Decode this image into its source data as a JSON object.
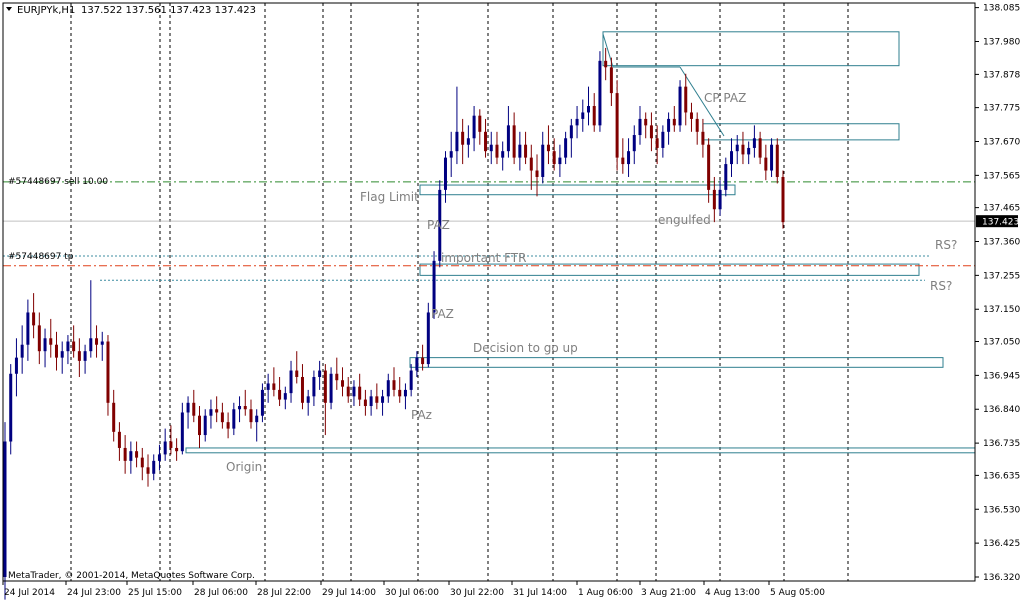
{
  "header": {
    "symbol_label": "EURJPYk,H1",
    "ohlc_label": "137.522 137.561 137.423 137.423"
  },
  "footer": {
    "copyright": "MetaTrader, © 2001-2014, MetaQuotes Software Corp."
  },
  "orders": {
    "sell_label": "#57448697 sell 10.00",
    "tp_label": "#57448697 tp"
  },
  "colors": {
    "background": "#ffffff",
    "grid": "#000000",
    "bull_candle": "#000080",
    "bear_candle": "#800000",
    "zone": "#2f7f8f",
    "annotation_text": "#808080",
    "sell_line": "#2e8b2e",
    "tp_line": "#e0401a",
    "dotted_level": "#3c8ca0",
    "bid_box": "#000000"
  },
  "chart_data": {
    "type": "candlestick",
    "title": "EURJPYk,H1",
    "ylim": [
      136.32,
      138.09
    ],
    "y_ticks": [
      "138.085",
      "137.980",
      "137.878",
      "137.775",
      "137.670",
      "137.565",
      "137.465",
      "137.360",
      "137.255",
      "137.150",
      "137.050",
      "136.945",
      "136.840",
      "136.735",
      "136.635",
      "136.530",
      "136.425",
      "136.320"
    ],
    "x_ticks": [
      "24 Jul 2014",
      "24 Jul 23:00",
      "25 Jul 15:00",
      "28 Jul 06:00",
      "28 Jul 22:00",
      "29 Jul 14:00",
      "30 Jul 06:00",
      "30 Jul 22:00",
      "31 Jul 14:00",
      "1 Aug 06:00",
      "3 Aug 21:00",
      "4 Aug 13:00",
      "5 Aug 05:00"
    ],
    "current_price": "137.423",
    "sell_level": 137.545,
    "tp_level": 137.285,
    "resistance_levels": [
      137.315,
      137.24
    ],
    "zones": [
      {
        "label": "",
        "y_top": 138.01,
        "y_bottom": 137.905
      },
      {
        "label": "",
        "y_top": 137.725,
        "y_bottom": 137.675
      },
      {
        "label": "",
        "y_top": 137.535,
        "y_bottom": 137.505
      },
      {
        "label": "",
        "y_top": 137.29,
        "y_bottom": 137.255
      },
      {
        "label": "",
        "y_top": 137.0,
        "y_bottom": 136.97
      },
      {
        "label": "",
        "y_top": 136.72,
        "y_bottom": 136.705
      }
    ],
    "annotations": [
      "CP PAZ",
      "Flag Limit",
      "PAZ",
      "engulfed",
      "important FTR",
      "RS?",
      "RS?",
      "PAZ",
      "Decision to go up",
      "PAz",
      "Origin"
    ],
    "candles": [
      [
        136.32,
        136.8,
        136.25,
        136.74
      ],
      [
        136.74,
        136.98,
        136.7,
        136.95
      ],
      [
        136.95,
        137.06,
        136.88,
        137.0
      ],
      [
        137.0,
        137.1,
        136.95,
        137.04
      ],
      [
        137.04,
        137.18,
        136.99,
        137.14
      ],
      [
        137.14,
        137.2,
        137.06,
        137.1
      ],
      [
        137.1,
        137.14,
        136.98,
        137.02
      ],
      [
        137.02,
        137.09,
        136.97,
        137.06
      ],
      [
        137.06,
        137.12,
        137.0,
        137.04
      ],
      [
        137.04,
        137.08,
        136.96,
        137.0
      ],
      [
        137.0,
        137.05,
        136.95,
        137.02
      ],
      [
        137.02,
        137.07,
        136.98,
        137.05
      ],
      [
        137.05,
        137.1,
        137.0,
        137.02
      ],
      [
        137.02,
        137.06,
        136.94,
        136.99
      ],
      [
        136.99,
        137.04,
        136.95,
        137.02
      ],
      [
        137.02,
        137.24,
        137.0,
        137.06
      ],
      [
        137.06,
        137.1,
        137.0,
        137.04
      ],
      [
        137.04,
        137.08,
        136.99,
        137.05
      ],
      [
        137.05,
        137.07,
        136.82,
        136.86
      ],
      [
        136.86,
        136.9,
        136.74,
        136.77
      ],
      [
        136.77,
        136.8,
        136.68,
        136.72
      ],
      [
        136.72,
        136.76,
        136.64,
        136.68
      ],
      [
        136.68,
        136.74,
        136.64,
        136.71
      ],
      [
        136.71,
        136.74,
        136.66,
        136.69
      ],
      [
        136.69,
        136.72,
        136.62,
        136.66
      ],
      [
        136.66,
        136.7,
        136.6,
        136.64
      ],
      [
        136.64,
        136.7,
        136.62,
        136.68
      ],
      [
        136.68,
        136.73,
        136.65,
        136.7
      ],
      [
        136.7,
        136.78,
        136.68,
        136.74
      ],
      [
        136.74,
        136.79,
        136.7,
        136.72
      ],
      [
        136.72,
        136.75,
        136.68,
        136.71
      ],
      [
        136.71,
        136.86,
        136.7,
        136.83
      ],
      [
        136.83,
        136.88,
        136.78,
        136.86
      ],
      [
        136.86,
        136.9,
        136.8,
        136.82
      ],
      [
        136.82,
        136.85,
        136.72,
        136.76
      ],
      [
        136.76,
        136.84,
        136.74,
        136.82
      ],
      [
        136.82,
        136.87,
        136.78,
        136.84
      ],
      [
        136.84,
        136.88,
        136.8,
        136.83
      ],
      [
        136.83,
        136.86,
        136.78,
        136.8
      ],
      [
        136.8,
        136.83,
        136.75,
        136.78
      ],
      [
        136.78,
        136.86,
        136.76,
        136.84
      ],
      [
        136.84,
        136.88,
        136.8,
        136.85
      ],
      [
        136.85,
        136.9,
        136.82,
        136.84
      ],
      [
        136.84,
        136.87,
        136.78,
        136.8
      ],
      [
        136.8,
        136.84,
        136.74,
        136.82
      ],
      [
        136.82,
        136.92,
        136.8,
        136.9
      ],
      [
        136.9,
        136.95,
        136.86,
        136.92
      ],
      [
        136.92,
        136.97,
        136.88,
        136.9
      ],
      [
        136.9,
        136.94,
        136.85,
        136.87
      ],
      [
        136.87,
        136.91,
        136.84,
        136.89
      ],
      [
        136.89,
        136.99,
        136.86,
        136.96
      ],
      [
        136.96,
        137.02,
        136.92,
        136.94
      ],
      [
        136.94,
        136.98,
        136.84,
        136.86
      ],
      [
        136.86,
        136.9,
        136.82,
        136.88
      ],
      [
        136.88,
        136.96,
        136.85,
        136.94
      ],
      [
        136.94,
        136.99,
        136.9,
        136.96
      ],
      [
        136.96,
        136.98,
        136.76,
        136.86
      ],
      [
        136.86,
        136.97,
        136.84,
        136.95
      ],
      [
        136.95,
        137.0,
        136.9,
        136.93
      ],
      [
        136.93,
        136.97,
        136.88,
        136.91
      ],
      [
        136.91,
        136.94,
        136.86,
        136.88
      ],
      [
        136.88,
        136.93,
        136.85,
        136.91
      ],
      [
        136.91,
        136.95,
        136.85,
        136.87
      ],
      [
        136.87,
        136.9,
        136.82,
        136.85
      ],
      [
        136.85,
        136.9,
        136.82,
        136.88
      ],
      [
        136.88,
        136.92,
        136.84,
        136.86
      ],
      [
        136.86,
        136.9,
        136.82,
        136.88
      ],
      [
        136.88,
        136.95,
        136.86,
        136.93
      ],
      [
        136.93,
        136.97,
        136.88,
        136.9
      ],
      [
        136.9,
        136.94,
        136.86,
        136.88
      ],
      [
        136.88,
        136.92,
        136.84,
        136.9
      ],
      [
        136.9,
        136.98,
        136.88,
        136.96
      ],
      [
        136.96,
        137.02,
        136.94,
        137.0
      ],
      [
        137.0,
        137.04,
        136.96,
        136.98
      ],
      [
        136.98,
        137.17,
        136.97,
        137.14
      ],
      [
        137.14,
        137.33,
        137.12,
        137.3
      ],
      [
        137.3,
        137.55,
        137.28,
        137.52
      ],
      [
        137.52,
        137.64,
        137.48,
        137.62
      ],
      [
        137.62,
        137.7,
        137.56,
        137.64
      ],
      [
        137.64,
        137.84,
        137.6,
        137.7
      ],
      [
        137.7,
        137.74,
        137.6,
        137.66
      ],
      [
        137.66,
        137.72,
        137.62,
        137.68
      ],
      [
        137.68,
        137.78,
        137.64,
        137.75
      ],
      [
        137.75,
        137.77,
        137.66,
        137.7
      ],
      [
        137.7,
        137.74,
        137.62,
        137.64
      ],
      [
        137.64,
        137.7,
        137.6,
        137.66
      ],
      [
        137.66,
        137.7,
        137.6,
        137.62
      ],
      [
        137.62,
        137.67,
        137.58,
        137.64
      ],
      [
        137.64,
        137.78,
        137.62,
        137.72
      ],
      [
        137.72,
        137.76,
        137.6,
        137.62
      ],
      [
        137.62,
        137.7,
        137.58,
        137.66
      ],
      [
        137.66,
        137.7,
        137.6,
        137.62
      ],
      [
        137.62,
        137.66,
        137.52,
        137.58
      ],
      [
        137.58,
        137.63,
        137.5,
        137.56
      ],
      [
        137.56,
        137.7,
        137.54,
        137.66
      ],
      [
        137.66,
        137.72,
        137.6,
        137.64
      ],
      [
        137.64,
        137.68,
        137.58,
        137.6
      ],
      [
        137.6,
        137.66,
        137.56,
        137.62
      ],
      [
        137.62,
        137.7,
        137.6,
        137.68
      ],
      [
        137.68,
        137.74,
        137.62,
        137.72
      ],
      [
        137.72,
        137.78,
        137.68,
        137.74
      ],
      [
        137.74,
        137.8,
        137.7,
        137.76
      ],
      [
        137.76,
        137.84,
        137.72,
        137.78
      ],
      [
        137.78,
        137.82,
        137.7,
        137.72
      ],
      [
        137.72,
        137.95,
        137.7,
        137.92
      ],
      [
        137.92,
        137.96,
        137.86,
        137.9
      ],
      [
        137.9,
        137.93,
        137.78,
        137.82
      ],
      [
        137.82,
        137.86,
        137.58,
        137.62
      ],
      [
        137.62,
        137.68,
        137.57,
        137.6
      ],
      [
        137.6,
        137.68,
        137.56,
        137.64
      ],
      [
        137.64,
        137.72,
        137.6,
        137.69
      ],
      [
        137.69,
        137.78,
        137.66,
        137.74
      ],
      [
        137.74,
        137.76,
        137.68,
        137.72
      ],
      [
        137.72,
        137.76,
        137.64,
        137.68
      ],
      [
        137.68,
        137.72,
        137.6,
        137.65
      ],
      [
        137.65,
        137.72,
        137.62,
        137.7
      ],
      [
        137.7,
        137.76,
        137.66,
        137.74
      ],
      [
        137.74,
        137.78,
        137.7,
        137.72
      ],
      [
        137.72,
        137.86,
        137.7,
        137.84
      ],
      [
        137.84,
        137.88,
        137.72,
        137.76
      ],
      [
        137.76,
        137.79,
        137.7,
        137.74
      ],
      [
        137.74,
        137.76,
        137.66,
        137.7
      ],
      [
        137.7,
        137.74,
        137.62,
        137.66
      ],
      [
        137.66,
        137.68,
        137.48,
        137.52
      ],
      [
        137.52,
        137.56,
        137.42,
        137.46
      ],
      [
        137.46,
        137.55,
        137.44,
        137.52
      ],
      [
        137.52,
        137.62,
        137.5,
        137.6
      ],
      [
        137.6,
        137.68,
        137.56,
        137.64
      ],
      [
        137.64,
        137.69,
        137.6,
        137.66
      ],
      [
        137.66,
        137.7,
        137.6,
        137.63
      ],
      [
        137.63,
        137.67,
        137.6,
        137.65
      ],
      [
        137.65,
        137.72,
        137.62,
        137.68
      ],
      [
        137.68,
        137.7,
        137.6,
        137.62
      ],
      [
        137.62,
        137.66,
        137.55,
        137.58
      ],
      [
        137.58,
        137.68,
        137.56,
        137.66
      ],
      [
        137.66,
        137.68,
        137.54,
        137.56
      ],
      [
        137.56,
        137.58,
        137.4,
        137.42
      ]
    ]
  }
}
